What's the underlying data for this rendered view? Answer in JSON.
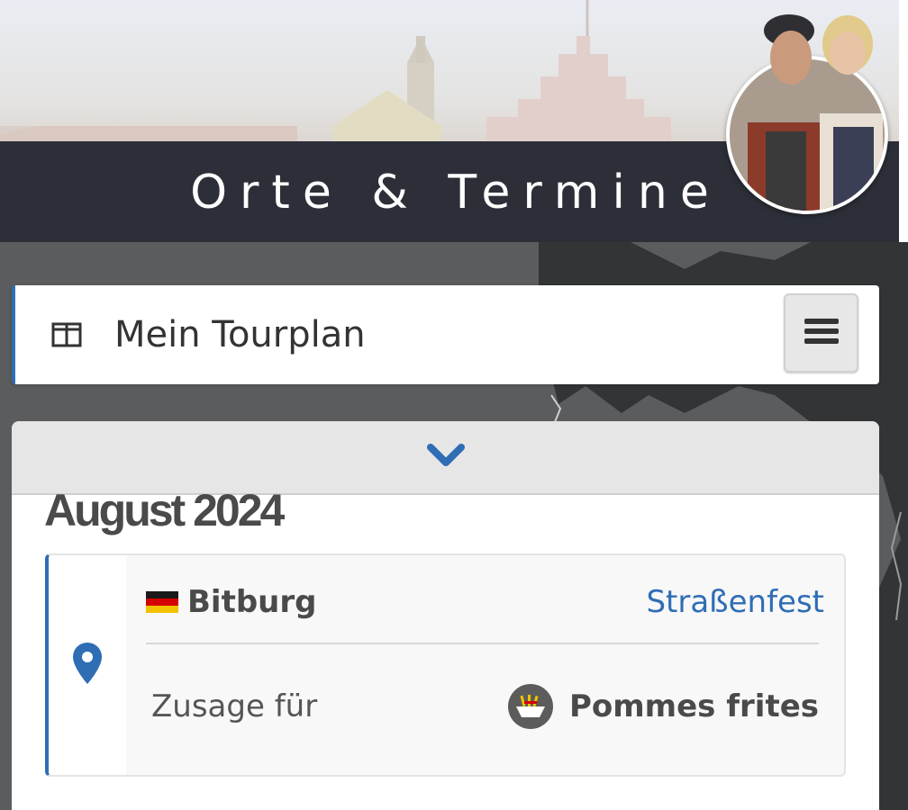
{
  "header": {
    "title": "Orte & Termine"
  },
  "tourplan": {
    "label": "Mein Tourplan",
    "icon": "columns-icon",
    "menu_icon": "hamburger-menu-icon"
  },
  "panel": {
    "collapse_icon": "chevron-down-icon",
    "month": "August 2024",
    "events": [
      {
        "city": "Bitburg",
        "flag": "germany-flag",
        "event_type": "Straßenfest",
        "commitment_label": "Zusage für",
        "product": "Pommes frites",
        "product_icon": "fries-icon"
      }
    ]
  },
  "colors": {
    "accent_blue": "#2f6db5",
    "header_dark": "#2c2f38",
    "map_gray": "#5b5c5d"
  }
}
